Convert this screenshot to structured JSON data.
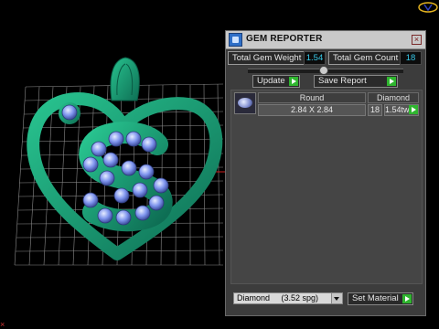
{
  "window": {
    "title": "GEM REPORTER",
    "close_icon": "close-icon",
    "app_icon": "gem-reporter-icon"
  },
  "summary": {
    "weight_label": "Total Gem Weight",
    "weight_value": "1.54",
    "count_label": "Total Gem Count",
    "count_value": "18"
  },
  "actions": {
    "update_label": "Update",
    "save_label": "Save Report"
  },
  "gem_table": {
    "columns": [
      "Round",
      "Diamond"
    ],
    "rows": [
      {
        "size": "2.84 X 2.84",
        "count": "18",
        "weight": "1.54tw"
      }
    ]
  },
  "material": {
    "selected": "Diamond     (3.52 spg)",
    "set_label": "Set Material"
  },
  "colors": {
    "model": "#1aa57a",
    "gem": "#8fa4ff",
    "accent_value": "#37c9e8",
    "go_button": "#2fb52f"
  }
}
